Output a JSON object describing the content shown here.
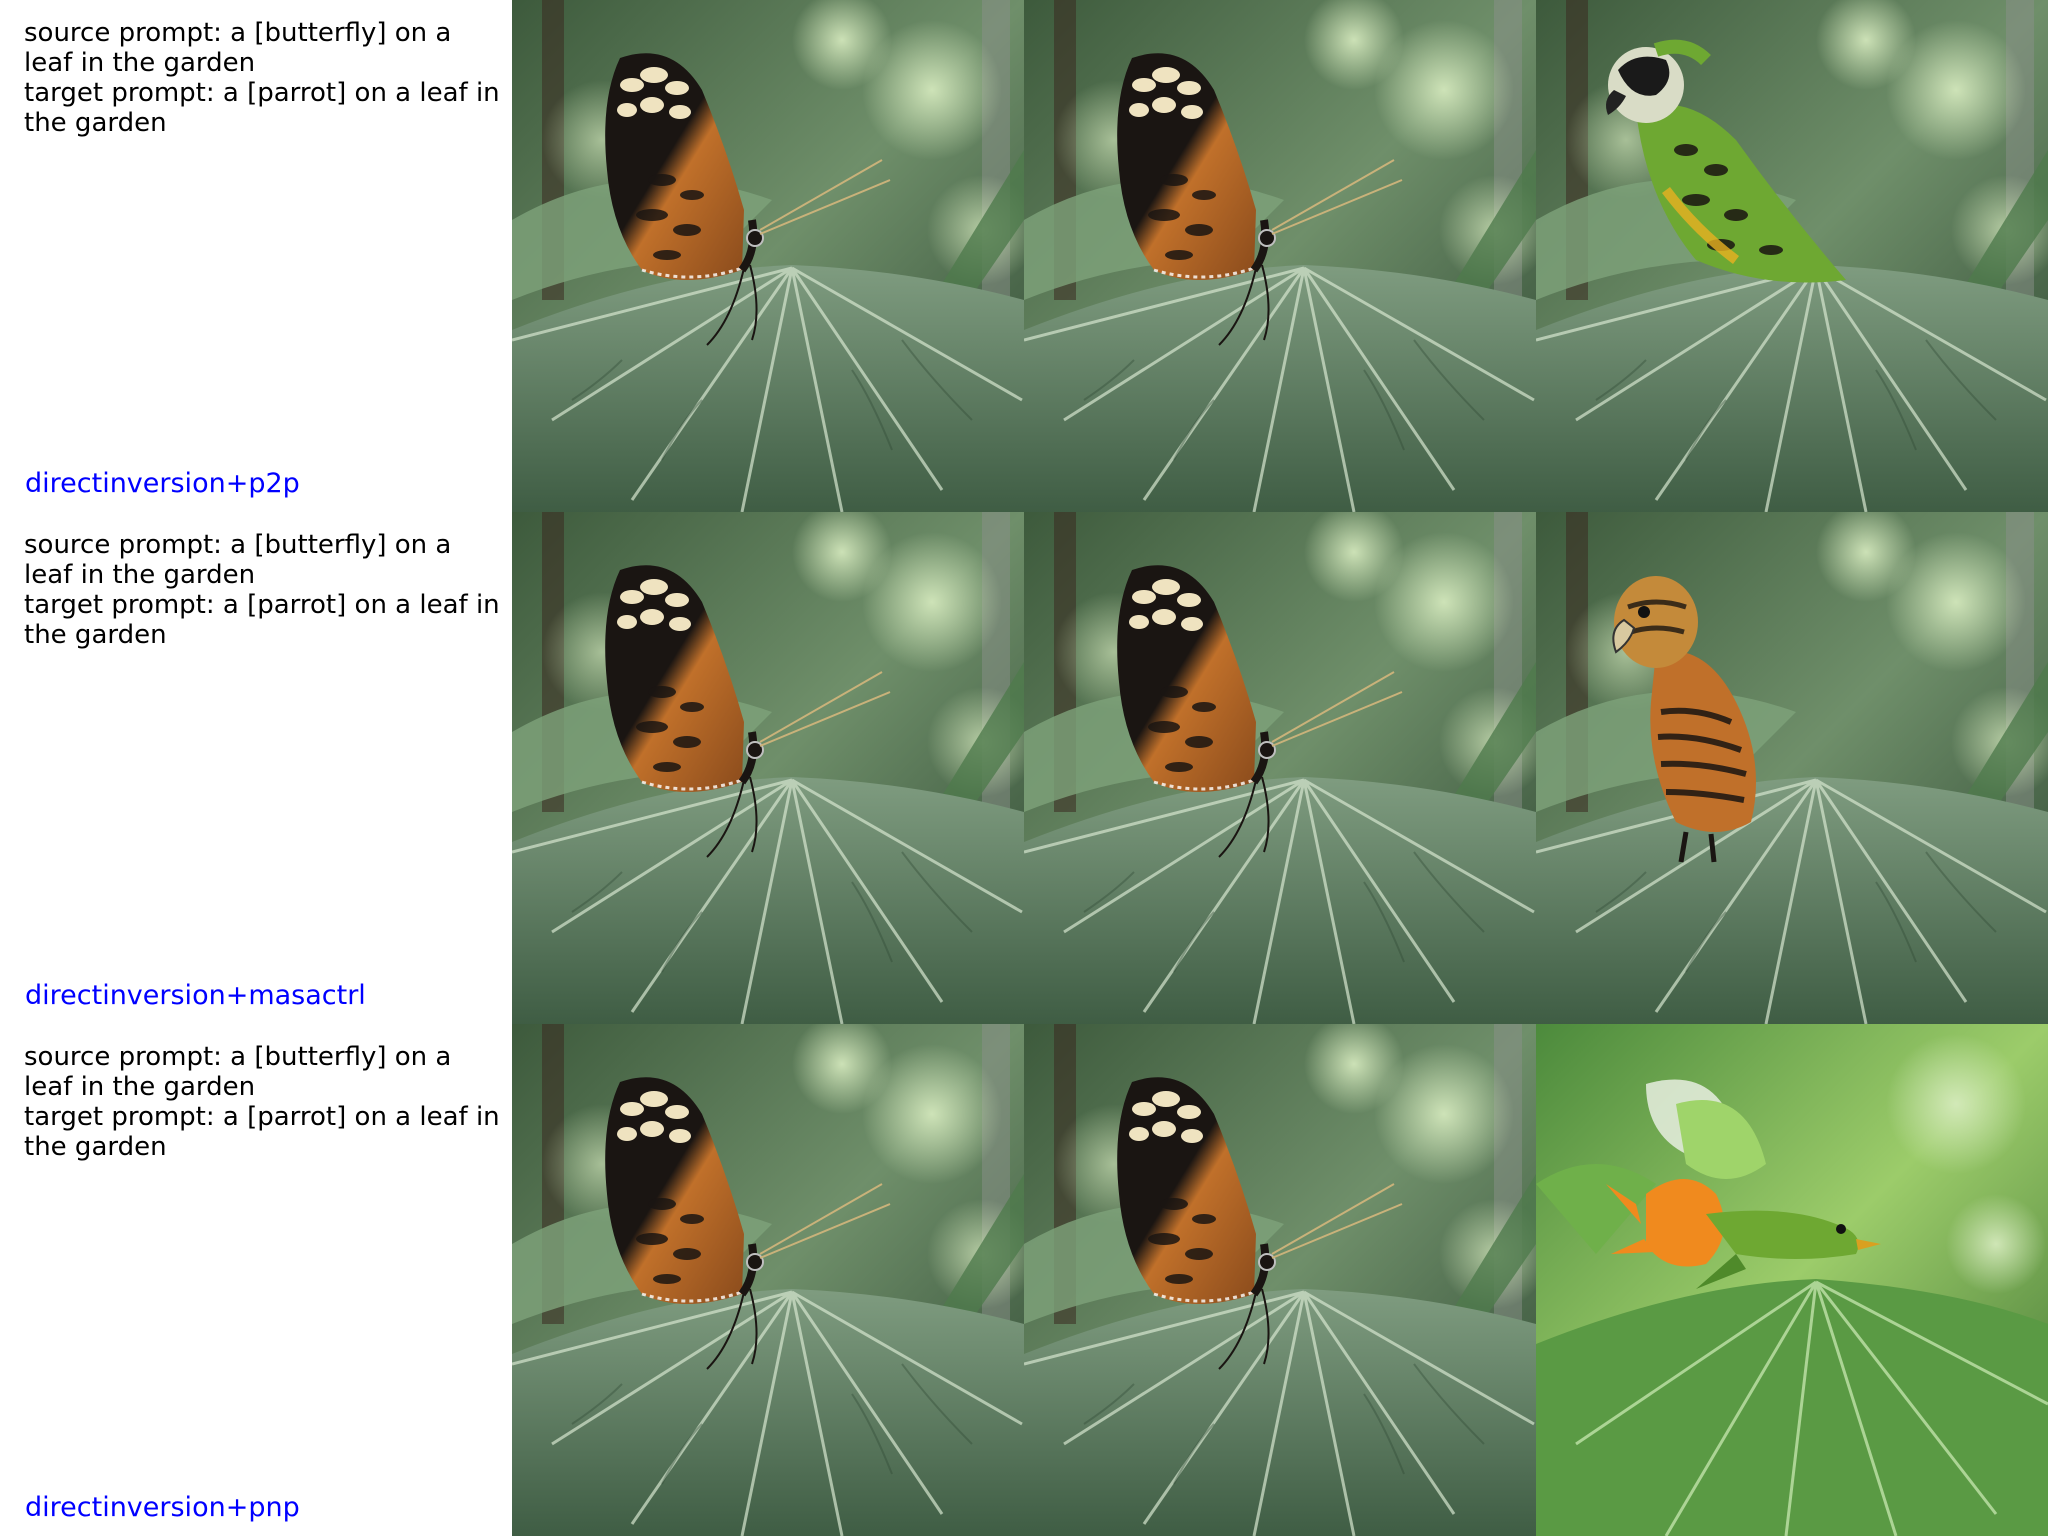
{
  "rows": [
    {
      "source_prompt": "source prompt: a [butterfly] on a leaf in the garden",
      "target_prompt": "target prompt: a [parrot] on a leaf in the garden",
      "method": "directinversion+p2p"
    },
    {
      "source_prompt": "source prompt: a [butterfly] on a leaf in the garden",
      "target_prompt": "target prompt: a [parrot] on a leaf in the garden",
      "method": "directinversion+masactrl"
    },
    {
      "source_prompt": "source prompt: a [butterfly] on a leaf in the garden",
      "target_prompt": "target prompt: a [parrot] on a leaf in the garden",
      "method": "directinversion+pnp"
    }
  ],
  "colors": {
    "method_label": "#0000ff",
    "prompt_text": "#000000",
    "foliage_dark": "#2f4a33",
    "foliage_mid": "#5f7d5c",
    "foliage_light": "#a9c39a",
    "butterfly_orange": "#c0702a",
    "butterfly_black": "#1a1512",
    "butterfly_cream": "#efe3c0",
    "parrot_green": "#6ea832",
    "parrot_orange": "#f08a1e"
  },
  "images": [
    [
      "butterfly-photo",
      "butterfly-photo",
      "parrot-green-edit"
    ],
    [
      "butterfly-photo",
      "butterfly-photo",
      "parrot-orange-striped-edit"
    ],
    [
      "butterfly-photo",
      "butterfly-photo",
      "parrot-green-orange-edit"
    ]
  ]
}
